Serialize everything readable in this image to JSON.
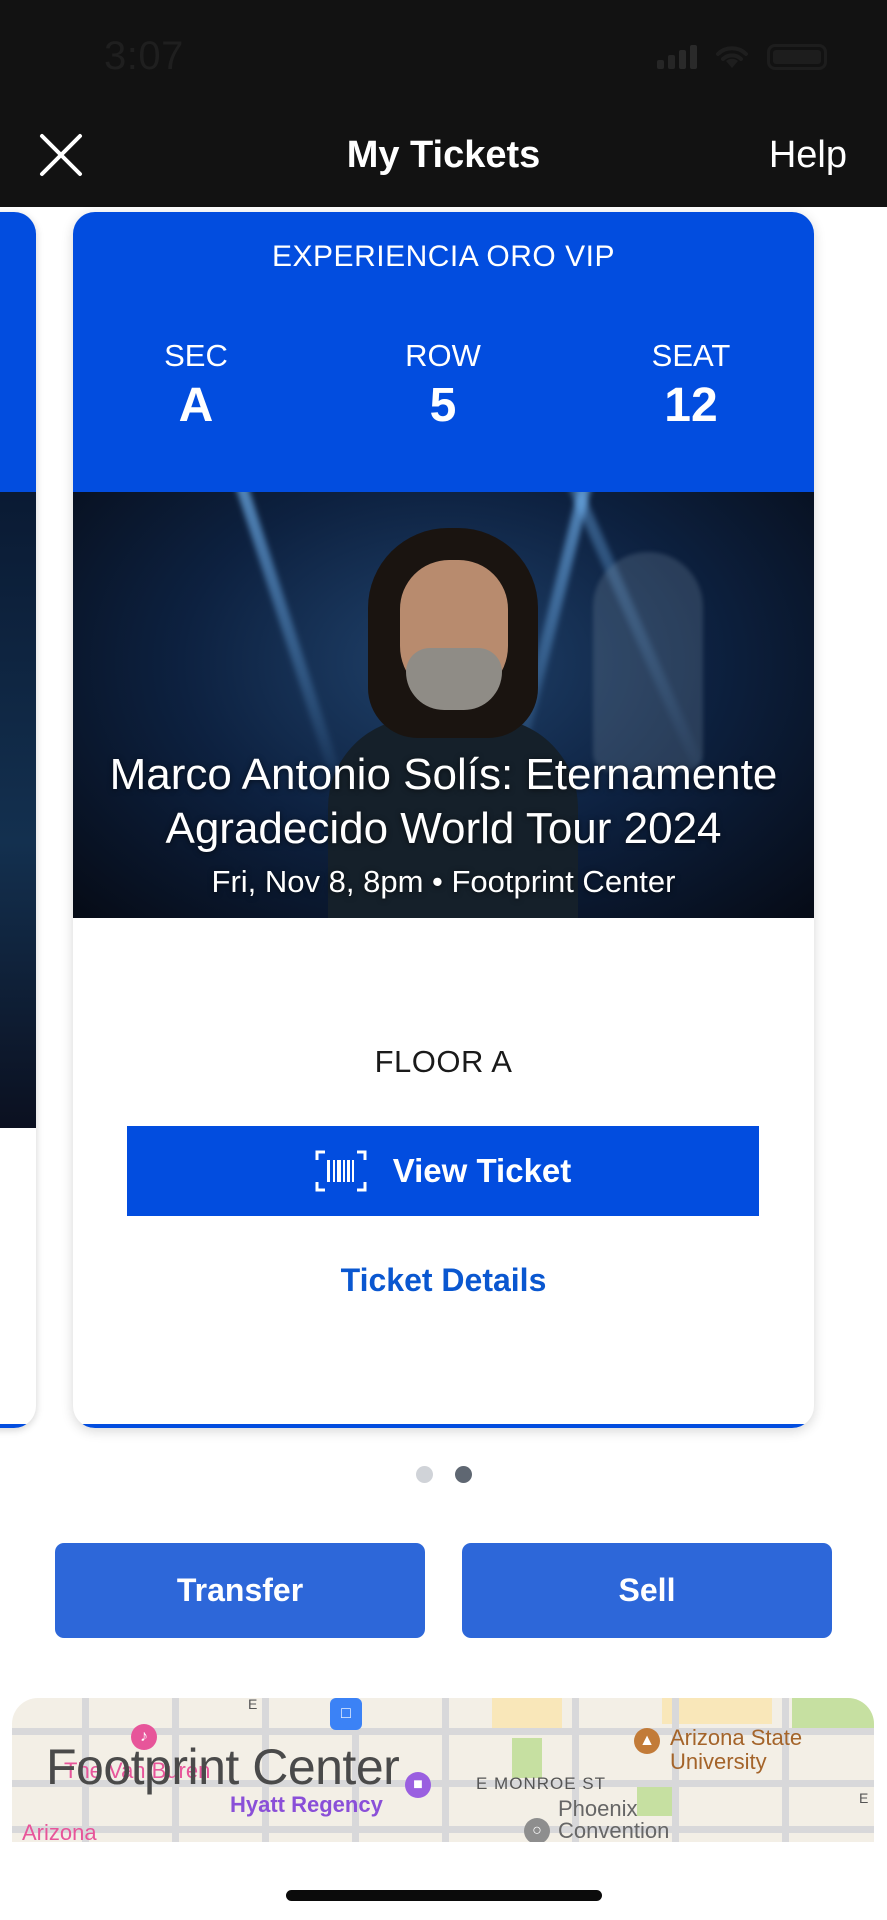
{
  "status_bar": {
    "time": "3:07"
  },
  "nav": {
    "title": "My Tickets",
    "help_label": "Help"
  },
  "ticket": {
    "section_name": "EXPERIENCIA ORO VIP",
    "sec_label": "SEC",
    "sec_value": "A",
    "row_label": "ROW",
    "row_value": "5",
    "seat_label": "SEAT",
    "seat_value": "12",
    "event_title_line1": "Marco Antonio Solís: Eternamente",
    "event_title_line2": "Agradecido World Tour 2024",
    "event_subtitle": "Fri, Nov 8, 8pm • Footprint Center",
    "entrance": "FLOOR A",
    "view_ticket_label": "View Ticket",
    "details_label": "Ticket Details"
  },
  "carousel": {
    "page_count": 2,
    "active_index": 1
  },
  "actions": {
    "transfer_label": "Transfer",
    "sell_label": "Sell"
  },
  "map": {
    "venue_label": "Footprint Center",
    "labels": {
      "van_buren": "The Van Buren",
      "hyatt": "Hyatt Regency",
      "arizona": "Arizona",
      "asu_line1": "Arizona State",
      "asu_line2": "University",
      "monroe": "E MONROE ST",
      "phoenix_line1": "Phoenix",
      "phoenix_line2": "Convention",
      "street_e1": "E",
      "street_e2": "E"
    }
  },
  "colors": {
    "ticket_blue": "#024ddf",
    "button_blue": "#2d67d9",
    "link_blue": "#0a57d0",
    "nav_bg": "#121212"
  }
}
